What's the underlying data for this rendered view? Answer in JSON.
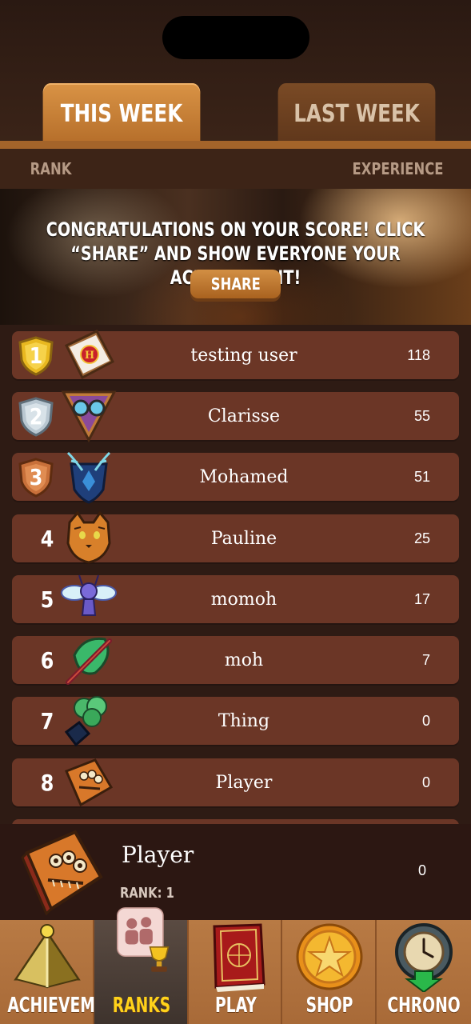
{
  "tabs": {
    "this_week": "THIS WEEK",
    "last_week": "LAST WEEK"
  },
  "columns": {
    "rank": "RANK",
    "experience": "EXPERIENCE"
  },
  "banner": {
    "message": "CONGRATULATIONS ON YOUR SCORE! CLICK “SHARE” AND SHOW EVERYONE YOUR ACHIEVEMENT!",
    "share_label": "SHARE"
  },
  "leaderboard": [
    {
      "rank": "1",
      "name": "testing user",
      "xp": "118",
      "icon": "envelope-h-icon",
      "medal": "gold-shield-icon"
    },
    {
      "rank": "2",
      "name": "Clarisse",
      "xp": "55",
      "icon": "goggles-icon",
      "medal": "silver-shield-icon"
    },
    {
      "rank": "3",
      "name": "Mohamed",
      "xp": "51",
      "icon": "stag-crest-icon",
      "medal": "bronze-shield-icon"
    },
    {
      "rank": "4",
      "name": "Pauline",
      "xp": "25",
      "icon": "cat-icon"
    },
    {
      "rank": "5",
      "name": "momoh",
      "xp": "17",
      "icon": "pixie-icon"
    },
    {
      "rank": "6",
      "name": "moh",
      "xp": "7",
      "icon": "wand-icon"
    },
    {
      "rank": "7",
      "name": "Thing",
      "xp": "0",
      "icon": "potion-smoke-icon"
    },
    {
      "rank": "8",
      "name": "Player",
      "xp": "0",
      "icon": "monster-book-icon"
    }
  ],
  "current_player": {
    "name": "Player",
    "rank_label": "RANK: 1",
    "xp": "0",
    "icon": "monster-book-icon"
  },
  "nav": [
    {
      "label": "ACHIEVEMENTS",
      "icon": "gold-pyramid-icon",
      "active": false
    },
    {
      "label": "RANKS",
      "icon": "ranks-trophy-icon",
      "active": true
    },
    {
      "label": "PLAY",
      "icon": "spellbook-icon",
      "active": false
    },
    {
      "label": "SHOP",
      "icon": "gold-coin-icon",
      "active": false
    },
    {
      "label": "CHRONO",
      "icon": "stopwatch-icon",
      "active": false
    }
  ],
  "colors": {
    "accent": "#d99345",
    "row": "#6b3626",
    "active_nav_label": "#ffd21a"
  }
}
